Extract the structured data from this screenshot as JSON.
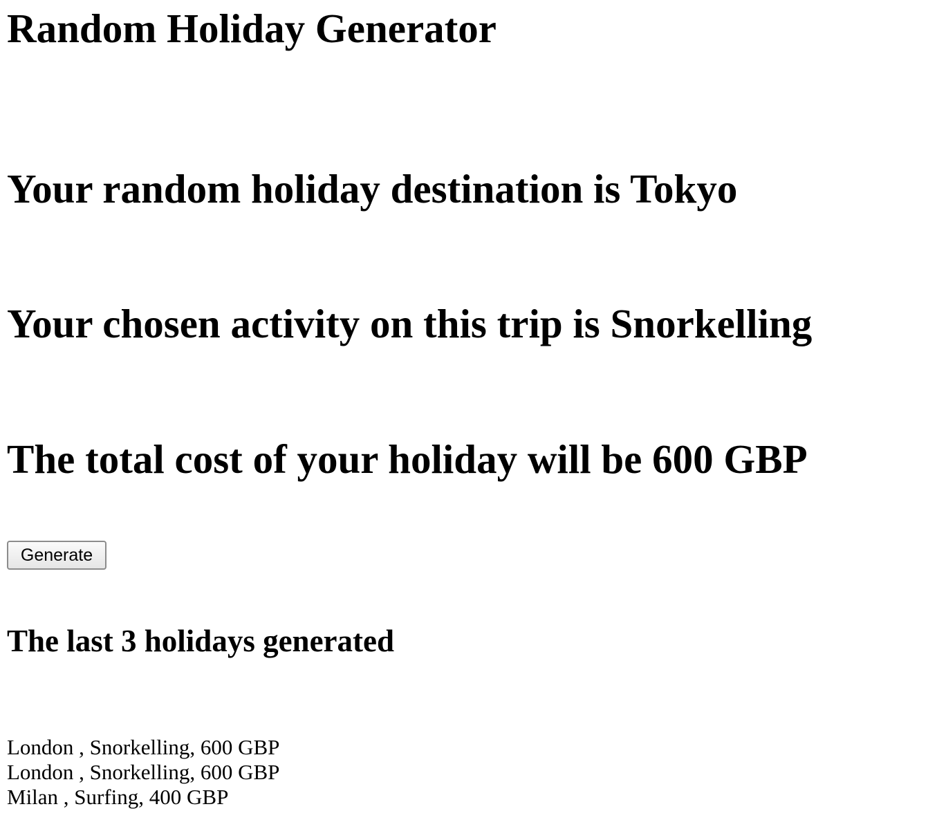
{
  "header": {
    "title": "Random Holiday Generator"
  },
  "result": {
    "destination_text": "Your random holiday destination is Tokyo",
    "activity_text": "Your chosen activity on this trip is Snorkelling",
    "cost_text": "The total cost of your holiday will be 600 GBP"
  },
  "controls": {
    "generate_label": "Generate"
  },
  "history": {
    "heading": "The last 3 holidays generated",
    "items": [
      "London , Snorkelling, 600 GBP",
      "London , Snorkelling, 600 GBP",
      "Milan , Surfing, 400 GBP"
    ]
  }
}
